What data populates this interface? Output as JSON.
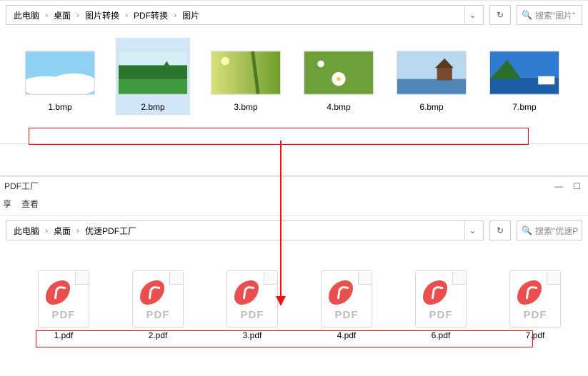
{
  "explorer1": {
    "breadcrumb": [
      "此电脑",
      "桌面",
      "图片转换",
      "PDF转换",
      "图片"
    ],
    "search_placeholder": "搜索\"图片\"",
    "files": [
      {
        "name": "1.bmp",
        "selected": false
      },
      {
        "name": "2.bmp",
        "selected": true
      },
      {
        "name": "3.bmp",
        "selected": false
      },
      {
        "name": "4.bmp",
        "selected": false
      },
      {
        "name": "6.bmp",
        "selected": false
      },
      {
        "name": "7.bmp",
        "selected": false
      }
    ]
  },
  "explorer2": {
    "title": "PDF工厂",
    "menu": [
      "享",
      "查看"
    ],
    "breadcrumb": [
      "此电脑",
      "桌面",
      "优速PDF工厂"
    ],
    "search_placeholder": "搜索\"优速P",
    "pdf_label": "PDF",
    "files": [
      {
        "name": "1.pdf"
      },
      {
        "name": "2.pdf"
      },
      {
        "name": "3.pdf"
      },
      {
        "name": "4.pdf"
      },
      {
        "name": "6.pdf"
      },
      {
        "name": "7.pdf"
      }
    ]
  },
  "icons": {
    "chevron_right": "›",
    "chevron_down": "⌄",
    "refresh": "↻",
    "search": "🔍",
    "min": "—",
    "square": "☐"
  }
}
